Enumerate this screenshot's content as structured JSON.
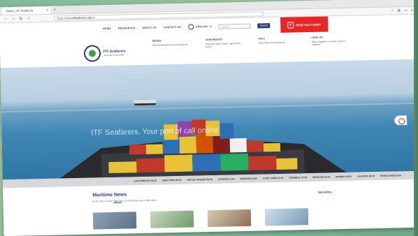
{
  "browser": {
    "tab_title": "Home | ITF Seafarers",
    "tab_close": "×",
    "new_tab": "+",
    "address_prefix": "https://www.",
    "address_domain": "itfseafarers.org",
    "address_suffix": "/en"
  },
  "header": {
    "nav": [
      "NEWS",
      "RESOURCES",
      "ABOUT US",
      "CONTACT US"
    ],
    "language": "ENGLISH",
    "search_placeholder": "Search",
    "search_button": "Search",
    "help_button": "NEED HELP NOW?"
  },
  "logo": {
    "name": "ITF Seafarers",
    "tagline": "Your port of call online"
  },
  "menu": [
    {
      "heading": "ISSUES",
      "text": "Understanding the issues faced at sea"
    },
    {
      "heading": "YOUR RIGHTS",
      "text": "Know your rights: wages, agreements, unions"
    },
    {
      "heading": "FOCs",
      "text": "About Flags of Convenience"
    },
    {
      "heading": "LOOK UP",
      "text": "Ships, inspectors or unions; tools for seafarers"
    }
  ],
  "hero": {
    "title": "ITF Seafarers. Your port of call online"
  },
  "clocks": [
    "LOS ANGELES 05:55",
    "NEW YORK 08:55",
    "RIO DE JANEIRO 09:55",
    "LONDON 13:55",
    "WARSAW 13:55",
    "CAPE TOWN 14:55",
    "ISTANBUL 15:55",
    "MOSCOW 15:55",
    "MUMBAI 18:25",
    "JAKARTA 19:55",
    "HONG KONG 20:55"
  ],
  "news": {
    "title": "Maritime News",
    "subtitle_before": "Be the first to know!",
    "subtitle_link": "Sign up",
    "subtitle_after": "to our breaking news e-mail alerts",
    "see_more": "SEE MORE ›"
  },
  "colors": {
    "brand": "#2a3d77",
    "help_red": "#e52727",
    "logo_green": "#39a149"
  }
}
